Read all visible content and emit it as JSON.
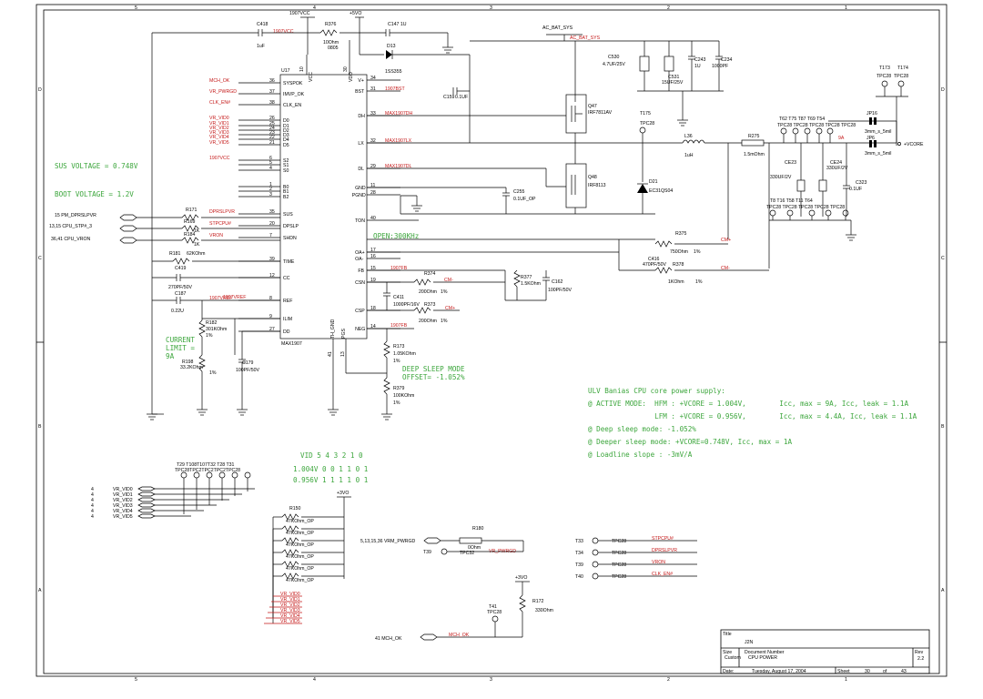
{
  "title_block": {
    "title_label": "Title",
    "title": "J2N",
    "size_label": "Size",
    "size": "Custom",
    "docnum_label": "Document Number",
    "docnum": "CPU POWER",
    "rev_label": "Rev",
    "rev": "2.2",
    "date_label": "Date:",
    "date": "Tuesday, August 17, 2004",
    "sheet_label": "Sheet",
    "sheet_no": "30",
    "of_label": "of",
    "sheet_total": "43"
  },
  "border": {
    "cols": [
      "5",
      "4",
      "3",
      "2",
      "1"
    ],
    "rows": [
      "D",
      "C",
      "B",
      "A"
    ]
  },
  "ic": {
    "ref": "U17",
    "part": "MAX1907",
    "top_pins": [
      "VCC",
      "VDD"
    ],
    "bottom_pins": [
      "TH_GND",
      "PGS"
    ],
    "left": [
      {
        "num": "36",
        "name": "SYSPOK",
        "net": "MCH_OK"
      },
      {
        "num": "37",
        "name": "IMVP_OK",
        "net": "VR_PWRGD"
      },
      {
        "num": "38",
        "name": "CLK_EN",
        "net": "CLK_EN#"
      },
      {
        "num": "26",
        "name": "D0",
        "net": "VR_VID0"
      },
      {
        "num": "25",
        "name": "D1",
        "net": "VR_VID1"
      },
      {
        "num": "24",
        "name": "D2",
        "net": "VR_VID2"
      },
      {
        "num": "23",
        "name": "D3",
        "net": "VR_VID3"
      },
      {
        "num": "22",
        "name": "D4",
        "net": "VR_VID4"
      },
      {
        "num": "21",
        "name": "D5",
        "net": "VR_VID5"
      },
      {
        "num": "6",
        "name": "S2",
        "net": "1907VCC"
      },
      {
        "num": "5",
        "name": "S1",
        "net": ""
      },
      {
        "num": "4",
        "name": "S0",
        "net": ""
      },
      {
        "num": "1",
        "name": "B0",
        "net": ""
      },
      {
        "num": "2",
        "name": "B1",
        "net": ""
      },
      {
        "num": "3",
        "name": "B2",
        "net": ""
      },
      {
        "num": "35",
        "name": "SUS",
        "net": "DPRSLPVR"
      },
      {
        "num": "20",
        "name": "DPSLP",
        "net": "STPCPU#"
      },
      {
        "num": "7",
        "name": "SHDN",
        "net": "VRON"
      },
      {
        "num": "39",
        "name": "TIME",
        "net": ""
      },
      {
        "num": "12",
        "name": "CC",
        "net": ""
      },
      {
        "num": "8",
        "name": "REF",
        "net": "1907VREF"
      },
      {
        "num": "9",
        "name": "ILIM",
        "net": ""
      },
      {
        "num": "27",
        "name": "DD",
        "net": ""
      }
    ],
    "right": [
      {
        "num": "34",
        "name": "V+",
        "net": ""
      },
      {
        "num": "31",
        "name": "BST",
        "net": "1907BST"
      },
      {
        "num": "33",
        "name": "DH",
        "net": "MAX1907DH"
      },
      {
        "num": "32",
        "name": "LX",
        "net": "MAX1907LX"
      },
      {
        "num": "29",
        "name": "DL",
        "net": "MAX1907DL"
      },
      {
        "num": "11",
        "name": "GND",
        "net": ""
      },
      {
        "num": "28",
        "name": "PGND",
        "net": ""
      },
      {
        "num": "40",
        "name": "TON",
        "net": ""
      },
      {
        "num": "17",
        "name": "OA+",
        "net": ""
      },
      {
        "num": "16",
        "name": "OA-",
        "net": ""
      },
      {
        "num": "15",
        "name": "FB",
        "net": "1907FB"
      },
      {
        "num": "19",
        "name": "CSN",
        "net": ""
      },
      {
        "num": "18",
        "name": "CSP",
        "net": ""
      },
      {
        "num": "14",
        "name": "NEG",
        "net": "1907FB"
      }
    ],
    "top_nums": [
      "10",
      "30"
    ],
    "bottom_nums": [
      "41",
      "13"
    ]
  },
  "labels": {
    "vcc_top": "1907VCC",
    "p5vo_top": "+5VO",
    "c418": "C418",
    "c418_val": "1uF",
    "c418_net": "1907VCC",
    "r376": "R376",
    "r376_val": "10Ohm",
    "r376_tol": "0805",
    "c147": "C147 1U",
    "d13": "D13",
    "d13_val": "1SS355",
    "c159": "C159",
    "c159_val": "0.1UF",
    "ac_bat_sys": "AC_BAT_SYS",
    "ac_bat_sys_red": "AC_BAT_SYS",
    "c530": "C530",
    "c530_val": "4.7UF/25V",
    "c531": "C531",
    "c531_val": "15UF/25V",
    "c243": "C243",
    "c243_val": "1U",
    "c234": "C234",
    "c234_val": "1000PF",
    "q47": "Q47",
    "q47_val": "IRF7811AV",
    "q48": "Q48",
    "q48_val": "IRF8113",
    "t175": "T175",
    "t175_val": "TPC28",
    "l36": "L36",
    "l36_val": "1uH",
    "r275": "R275",
    "r275_val": "1.5mOhm",
    "d21": "D21",
    "d21_val": "EC31QS04",
    "c255": "C255",
    "c255_val": "0.1UF_OP",
    "ce23": "CE23",
    "ce23_val": "330UF/2V",
    "ce24": "CE24",
    "ce24_val": "330UF/2V",
    "c323": "C323",
    "c323_val": "0.1UF",
    "t173": "T173",
    "t174": "T174",
    "tpc28a": "TPC28",
    "tpc28b": "TPC28",
    "jp16": "JP16",
    "jp16_val": "3mm_s_5mil",
    "jp6": "JP6",
    "jp6_val": "3mm_s_5mil",
    "vcore": "+VCORE",
    "current_9a": "9A",
    "tp_row1": "T62  T75  T87  T69  T54",
    "tp_row1_val": "TPC28 TPC28 TPC28 TPC28 TPC28",
    "tp_row2": "T8      T16     T58  T11   T64",
    "tp_row2_val": "TPC28 TPC28 TPC28 TPC28 TPC28",
    "r375": "R375",
    "r375_val": "750Ohm",
    "r375_tol": "1%",
    "cm_plus": "CM+",
    "c416": "C416",
    "c416_val": "470PF/50V",
    "r378": "R378",
    "r378_val": "1KOhm",
    "r378_tol": "1%",
    "cm_minus": "CM-",
    "r374": "R374",
    "r374_val": "200Ohm",
    "r374_tol": "1%",
    "cm_minus2": "CM-",
    "r377": "R377",
    "r377_val": "1.5KOhm",
    "c162": "C162",
    "c162_val": "100PF/50V",
    "c411": "C411",
    "c411_val": "1000PF/16V",
    "r373": "R373",
    "r373_val": "200Ohm",
    "r373_tol": "1%",
    "cm_plus2": "CM+",
    "r173": "R173",
    "r173_val": "1.05KOhm",
    "r173_tol": "1%",
    "r379": "R379",
    "r379_val": "100KOhm",
    "r379_tol": "1%",
    "r171": "R171",
    "r171_val": "1",
    "r169": "R169",
    "r169_val": "1K",
    "r184": "R184",
    "r184_val": "1K",
    "r181": "R181",
    "r181_val": "62KOhm",
    "c419": "C419",
    "c419_val": "270PF/50V",
    "c187": "C187",
    "c187_val": "0.22U",
    "r182": "R182",
    "r182_val": "301KOhm",
    "r182_tol": "1%",
    "r198": "R198",
    "r198_val": "33.2KOhm",
    "r198_tol": "1%",
    "c179": "C179",
    "c179_val": "100PF/50V",
    "sig_pm": "15   PM_DPRSLPVR",
    "sig_stp": "13,15  CPU_STP#_3",
    "sig_vron": "36,41  CPU_VRON",
    "sig_vrm": "5,13,15,36  VRM_PWRGD",
    "sig_mch": "41        MCH_OK",
    "net_mch_ok": "MCH_OK",
    "t39": "T39",
    "t39_val": "TPC32",
    "vr_pwrgd": "VR_PWRGD",
    "r180": "R180",
    "r180_val": "0Ohm",
    "p3vo_a": "+3VO",
    "p3vo_b": "+3VO",
    "r172": "R172",
    "r172_val": "330Ohm",
    "t41": "T41",
    "t41_val": "TPC28",
    "r150": "R150",
    "r_vid_val": "47KOhm_OP",
    "tp_vid": "T29  T108T107T32  T28  T31",
    "tp_vid_val": "TPC28TPC2TPC2TPC2TPC28"
  },
  "vid_ports": [
    "VR_VID0",
    "VR_VID1",
    "VR_VID2",
    "VR_VID3",
    "VR_VID4",
    "VR_VID5"
  ],
  "vid_port_pin": "4",
  "vid_bus": [
    "VR_VID0",
    "VR_VID1",
    "VR_VID2",
    "VR_VID3",
    "VR_VID4",
    "VR_VID5"
  ],
  "testpoints": [
    {
      "ref": "T33",
      "part": "TPC28",
      "net": "STPCPU#"
    },
    {
      "ref": "T34",
      "part": "TPC28",
      "net": "DPRSLPVR"
    },
    {
      "ref": "T39",
      "part": "TPC28",
      "net": "VRON"
    },
    {
      "ref": "T40",
      "part": "TPC28",
      "net": "CLK_EN#"
    }
  ],
  "notes": {
    "sus_voltage": "SUS VOLTAGE = 0.748V",
    "boot_voltage": "BOOT VOLTAGE = 1.2V",
    "open_freq": "OPEN:300KHz",
    "current_limit": [
      "CURRENT",
      "LIMIT =",
      "9A"
    ],
    "deep_sleep": [
      "DEEP SLEEP MODE",
      "OFFSET= -1.052%"
    ],
    "vid_table": [
      "VID 5 4 3 2 1 0",
      "1.004V 0 0 1 1 0 1",
      "0.956V 1 1 1 1 0 1"
    ],
    "ulv": [
      "ULV Banias CPU core power supply:",
      "@ ACTIVE MODE:  HFM : +VCORE = 1.004V,        Icc, max = 9A, Icc, leak = 1.1A",
      "                LFM : +VCORE = 0.956V,        Icc, max = 4.4A, Icc, leak = 1.1A",
      "@ Deep sleep mode: -1.052%",
      "@ Deeper sleep mode: +VCORE=0.748V, Icc, max = 1A",
      "@ Loadline slope : -3mV/A"
    ]
  }
}
